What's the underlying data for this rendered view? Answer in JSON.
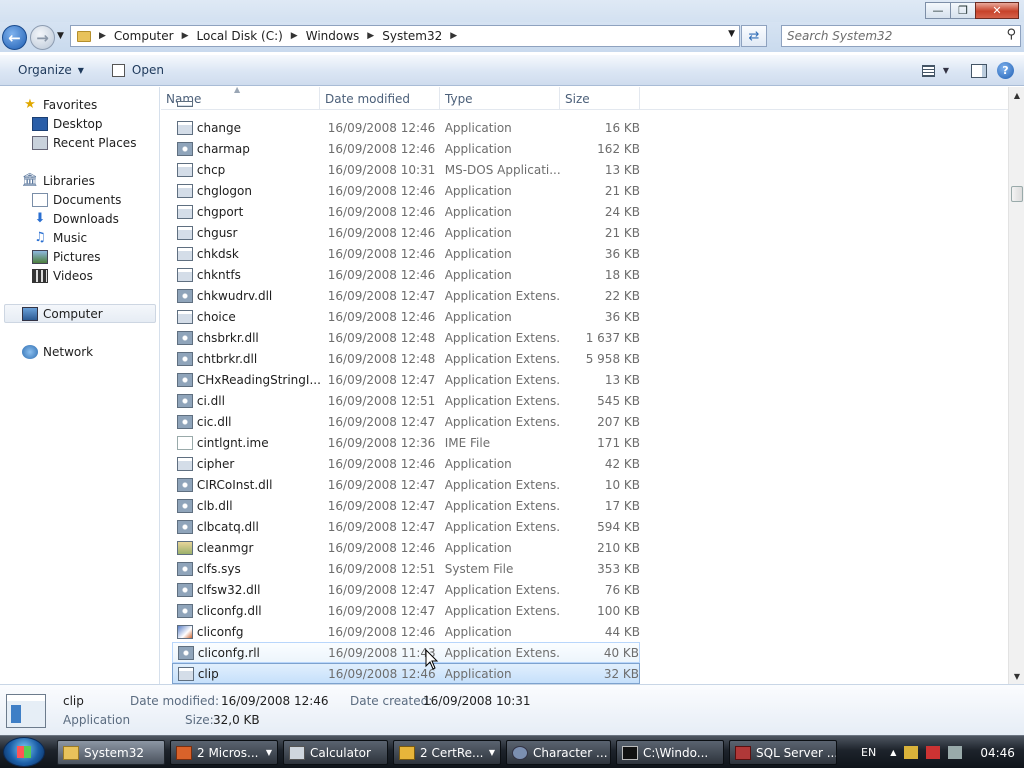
{
  "address": {
    "crumbs": [
      "Computer",
      "Local Disk (C:)",
      "Windows",
      "System32"
    ]
  },
  "search": {
    "placeholder": "Search System32"
  },
  "toolbar": {
    "organize_label": "Organize",
    "open_label": "Open"
  },
  "nav": {
    "favorites": "Favorites",
    "favorites_items": [
      "Desktop",
      "Recent Places"
    ],
    "libraries": "Libraries",
    "libraries_items": [
      "Documents",
      "Downloads",
      "Music",
      "Pictures",
      "Videos"
    ],
    "computer": "Computer",
    "network": "Network"
  },
  "columns": {
    "name": "Name",
    "date": "Date modified",
    "type": "Type",
    "size": "Size"
  },
  "files": [
    {
      "name": "change",
      "date": "16/09/2008 12:46",
      "type": "Application",
      "size": "16 KB",
      "icon": "app"
    },
    {
      "name": "charmap",
      "date": "16/09/2008 12:46",
      "type": "Application",
      "size": "162 KB",
      "icon": "gear"
    },
    {
      "name": "chcp",
      "date": "16/09/2008 10:31",
      "type": "MS-DOS Applicati...",
      "size": "13 KB",
      "icon": "app"
    },
    {
      "name": "chglogon",
      "date": "16/09/2008 12:46",
      "type": "Application",
      "size": "21 KB",
      "icon": "app"
    },
    {
      "name": "chgport",
      "date": "16/09/2008 12:46",
      "type": "Application",
      "size": "24 KB",
      "icon": "app"
    },
    {
      "name": "chgusr",
      "date": "16/09/2008 12:46",
      "type": "Application",
      "size": "21 KB",
      "icon": "app"
    },
    {
      "name": "chkdsk",
      "date": "16/09/2008 12:46",
      "type": "Application",
      "size": "36 KB",
      "icon": "app"
    },
    {
      "name": "chkntfs",
      "date": "16/09/2008 12:46",
      "type": "Application",
      "size": "18 KB",
      "icon": "app"
    },
    {
      "name": "chkwudrv.dll",
      "date": "16/09/2008 12:47",
      "type": "Application Extens...",
      "size": "22 KB",
      "icon": "gear"
    },
    {
      "name": "choice",
      "date": "16/09/2008 12:46",
      "type": "Application",
      "size": "36 KB",
      "icon": "app"
    },
    {
      "name": "chsbrkr.dll",
      "date": "16/09/2008 12:48",
      "type": "Application Extens...",
      "size": "1 637 KB",
      "icon": "gear"
    },
    {
      "name": "chtbrkr.dll",
      "date": "16/09/2008 12:48",
      "type": "Application Extens...",
      "size": "5 958 KB",
      "icon": "gear"
    },
    {
      "name": "CHxReadingStringI...",
      "date": "16/09/2008 12:47",
      "type": "Application Extens...",
      "size": "13 KB",
      "icon": "gear"
    },
    {
      "name": "ci.dll",
      "date": "16/09/2008 12:51",
      "type": "Application Extens...",
      "size": "545 KB",
      "icon": "gear"
    },
    {
      "name": "cic.dll",
      "date": "16/09/2008 12:47",
      "type": "Application Extens...",
      "size": "207 KB",
      "icon": "gear"
    },
    {
      "name": "cintlgnt.ime",
      "date": "16/09/2008 12:36",
      "type": "IME File",
      "size": "171 KB",
      "icon": "doc"
    },
    {
      "name": "cipher",
      "date": "16/09/2008 12:46",
      "type": "Application",
      "size": "42 KB",
      "icon": "app"
    },
    {
      "name": "CIRCoInst.dll",
      "date": "16/09/2008 12:47",
      "type": "Application Extens...",
      "size": "10 KB",
      "icon": "gear"
    },
    {
      "name": "clb.dll",
      "date": "16/09/2008 12:47",
      "type": "Application Extens...",
      "size": "17 KB",
      "icon": "gear"
    },
    {
      "name": "clbcatq.dll",
      "date": "16/09/2008 12:47",
      "type": "Application Extens...",
      "size": "594 KB",
      "icon": "gear"
    },
    {
      "name": "cleanmgr",
      "date": "16/09/2008 12:46",
      "type": "Application",
      "size": "210 KB",
      "icon": "clean"
    },
    {
      "name": "clfs.sys",
      "date": "16/09/2008 12:51",
      "type": "System File",
      "size": "353 KB",
      "icon": "gear"
    },
    {
      "name": "clfsw32.dll",
      "date": "16/09/2008 12:47",
      "type": "Application Extens...",
      "size": "76 KB",
      "icon": "gear"
    },
    {
      "name": "cliconfg.dll",
      "date": "16/09/2008 12:47",
      "type": "Application Extens...",
      "size": "100 KB",
      "icon": "gear"
    },
    {
      "name": "cliconfg",
      "date": "16/09/2008 12:46",
      "type": "Application",
      "size": "44 KB",
      "icon": "cfg"
    },
    {
      "name": "cliconfg.rll",
      "date": "16/09/2008 11:43",
      "type": "Application Extens...",
      "size": "40 KB",
      "icon": "gear",
      "state": "hover"
    },
    {
      "name": "clip",
      "date": "16/09/2008 12:46",
      "type": "Application",
      "size": "32 KB",
      "icon": "app",
      "state": "selected"
    }
  ],
  "details": {
    "name": "clip",
    "type": "Application",
    "modified_label": "Date modified:",
    "modified_value": "16/09/2008 12:46",
    "size_label": "Size:",
    "size_value": "32,0 KB",
    "created_label": "Date created:",
    "created_value": "16/09/2008 10:31"
  },
  "taskbar": {
    "items": [
      {
        "label": "System32",
        "icon": "folder",
        "active": true
      },
      {
        "label": "2 Micros...",
        "icon": "word",
        "active": false,
        "grouped": true
      },
      {
        "label": "Calculator",
        "icon": "calc",
        "active": false
      },
      {
        "label": "2 CertRe...",
        "icon": "cert",
        "active": false,
        "grouped": true
      },
      {
        "label": "Character ...",
        "icon": "char",
        "active": false
      },
      {
        "label": "C:\\Windo...",
        "icon": "cmd",
        "active": false
      },
      {
        "label": "SQL Server ...",
        "icon": "sql",
        "active": false
      }
    ],
    "language": "EN",
    "clock": "04:46"
  }
}
